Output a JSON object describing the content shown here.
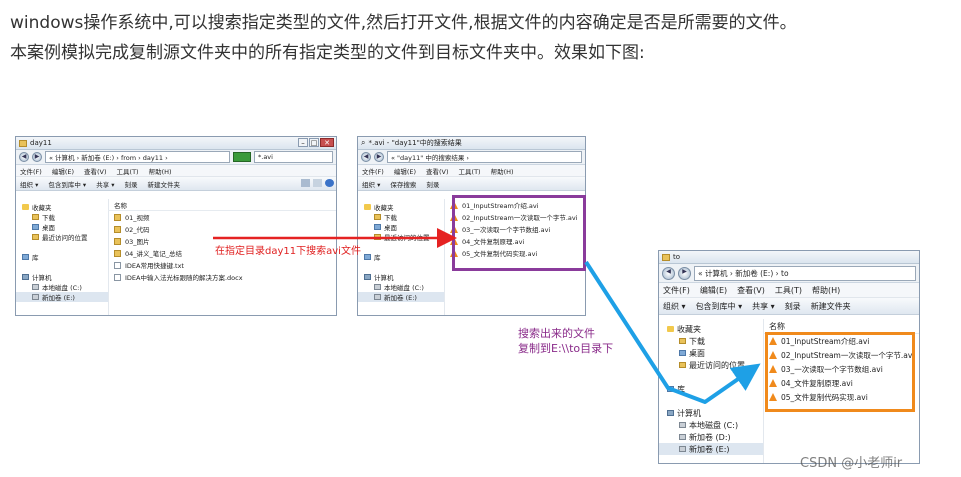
{
  "intro": {
    "line1": "windows操作系统中,可以搜索指定类型的文件,然后打开文件,根据文件的内容确定是否是所需要的文件。",
    "line2": "本案例模拟完成复制源文件夹中的所有指定类型的文件到目标文件夹中。效果如下图:"
  },
  "colors": {
    "red_arrow": "#e52222",
    "blue_arrow": "#1ea0e6",
    "purple_box": "#8a3b9b",
    "orange_box": "#f08a1c",
    "annotation_red": "#e02020"
  },
  "win1": {
    "title": "day11",
    "address": "« 计算机 › 新加卷 (E:) › from › day11 ›",
    "search": "*.avi",
    "menu": [
      "文件(F)",
      "编辑(E)",
      "查看(V)",
      "工具(T)",
      "帮助(H)"
    ],
    "commands": [
      "组织 ▾",
      "包含到库中 ▾",
      "共享 ▾",
      "刻录",
      "新建文件夹"
    ],
    "nav": {
      "favorites": "收藏夹",
      "downloads": "下载",
      "desktop": "桌面",
      "recent": "最近访问的位置",
      "library": "库",
      "computer": "计算机",
      "local_c": "本地磁盘 (C:)",
      "new_e": "新加卷 (E:)"
    },
    "column_name": "名称",
    "files": [
      "01_视频",
      "02_代码",
      "03_图片",
      "04_讲义_笔记_总结",
      "IDEA常用快捷键.txt",
      "IDEA中输入法光标跟随的解决方案.docx"
    ]
  },
  "win2": {
    "title": "*.avi - \"day11\"中的搜索结果",
    "address": "« \"day11\" 中的搜索结果 ›",
    "menu": [
      "文件(F)",
      "编辑(E)",
      "查看(V)",
      "工具(T)",
      "帮助(H)"
    ],
    "commands": [
      "组织 ▾",
      "保存搜索",
      "刻录"
    ],
    "nav": {
      "favorites": "收藏夹",
      "downloads": "下载",
      "desktop": "桌面",
      "recent": "最近访问的位置",
      "library": "库",
      "computer": "计算机",
      "local_c": "本地磁盘 (C:)",
      "new_e": "新加卷 (E:)"
    },
    "files": [
      "01_InputStream介绍.avi",
      "02_InputStream一次读取一个字节.avi",
      "03_一次读取一个字节数组.avi",
      "04_文件复制原理.avi",
      "05_文件复制代码实现.avi"
    ]
  },
  "win3": {
    "title": "to",
    "address": "« 计算机 › 新加卷 (E:) › to",
    "menu": [
      "文件(F)",
      "编辑(E)",
      "查看(V)",
      "工具(T)",
      "帮助(H)"
    ],
    "commands": [
      "组织 ▾",
      "包含到库中 ▾",
      "共享 ▾",
      "刻录",
      "新建文件夹"
    ],
    "nav": {
      "favorites": "收藏夹",
      "downloads": "下载",
      "desktop": "桌面",
      "recent": "最近访问的位置",
      "library": "库",
      "computer": "计算机",
      "local_c": "本地磁盘 (C:)",
      "new_d": "新加卷 (D:)",
      "new_e": "新加卷 (E:)"
    },
    "column_name": "名称",
    "files": [
      "01_InputStream介绍.avi",
      "02_InputStream一次读取一个字节.avi",
      "03_一次读取一个字节数组.avi",
      "04_文件复制原理.avi",
      "05_文件复制代码实现.avi"
    ]
  },
  "annotations": {
    "search_note": "在指定目录day11下搜索avi文件",
    "copy_note_line1": "搜索出来的文件",
    "copy_note_line2": "复制到E:\\\\to目录下"
  },
  "watermark": "CSDN @小老师ir"
}
